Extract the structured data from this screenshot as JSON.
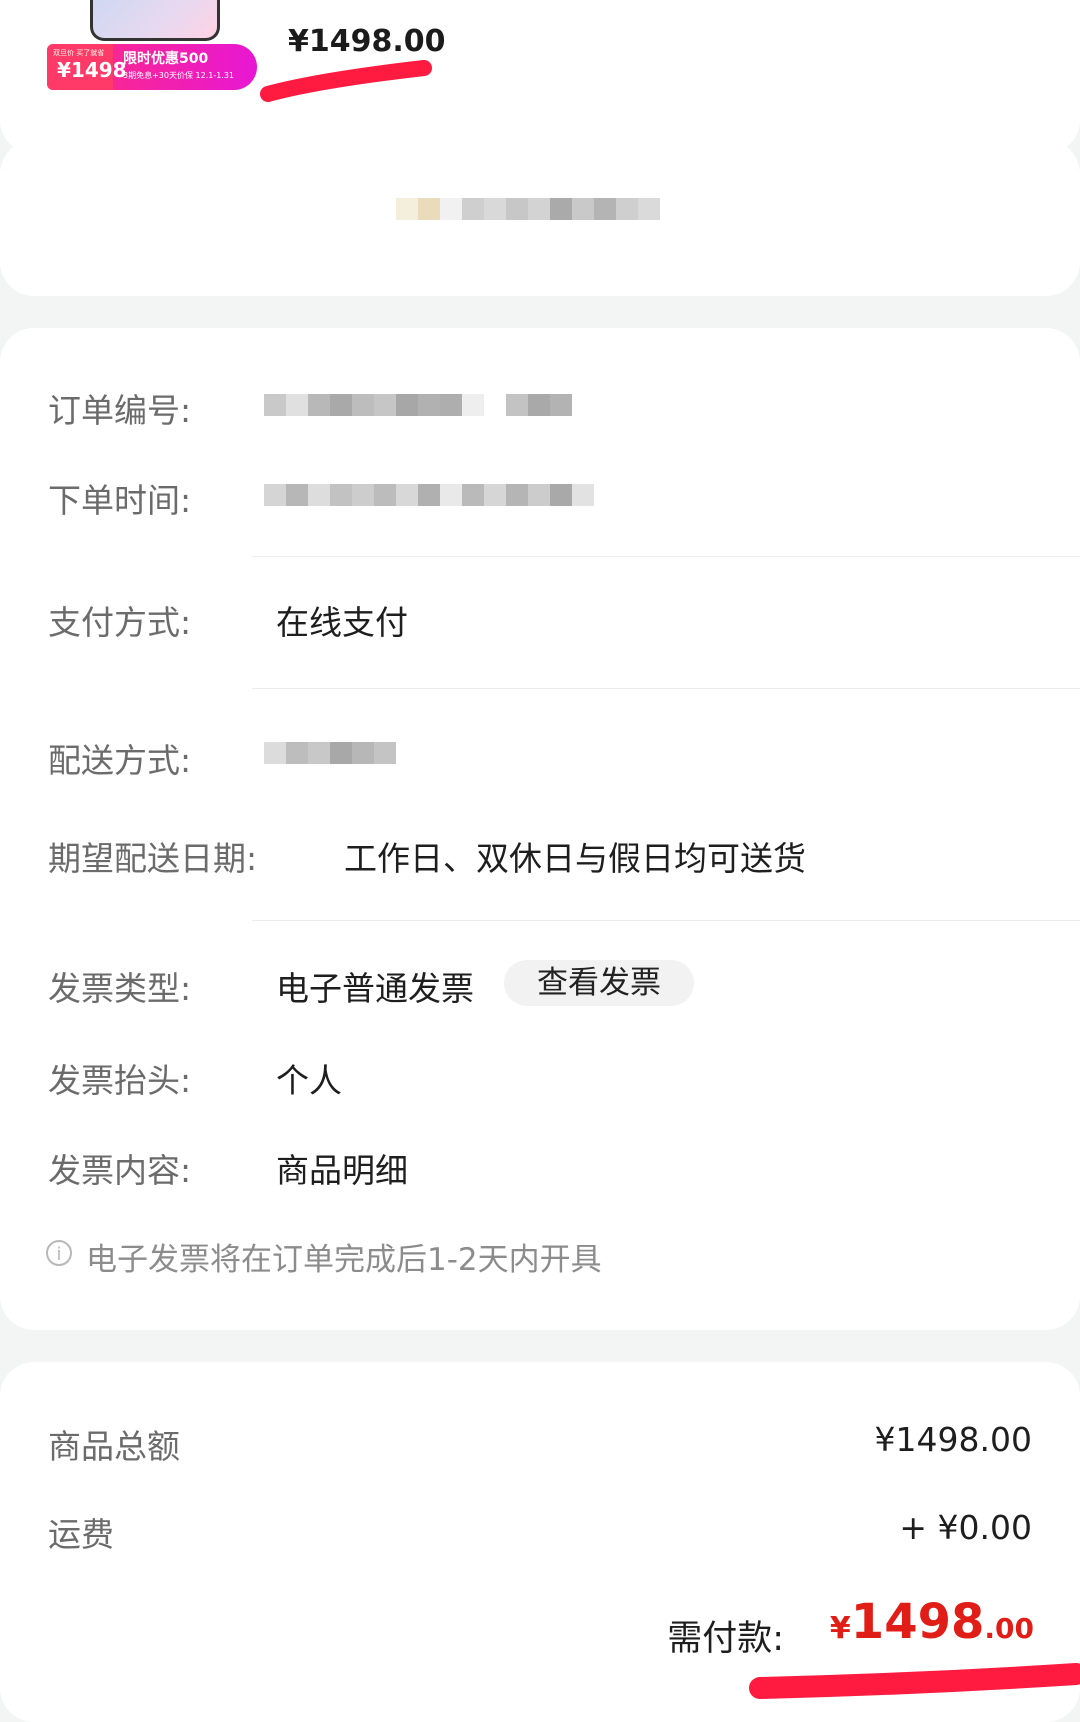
{
  "product": {
    "price": "¥1498.00",
    "promo": {
      "badge": "双旦价 买了就省",
      "price": "¥1498",
      "title": "限时优惠500",
      "subtitle": "3期免息+30天价保 12.1-1.31"
    }
  },
  "order_info": {
    "order_number_label": "订单编号:",
    "order_time_label": "下单时间:",
    "payment_label": "支付方式:",
    "payment_value": "在线支付",
    "delivery_label": "配送方式:",
    "expected_delivery_label": "期望配送日期:",
    "expected_delivery_value": "工作日、双休日与假日均可送货",
    "invoice_type_label": "发票类型:",
    "invoice_type_value": "电子普通发票",
    "view_invoice_button": "查看发票",
    "invoice_title_label": "发票抬头:",
    "invoice_title_value": "个人",
    "invoice_content_label": "发票内容:",
    "invoice_content_value": "商品明细",
    "note": "电子发票将在订单完成后1-2天内开具"
  },
  "summary": {
    "goods_total_label": "商品总额",
    "goods_total_value": "¥1498.00",
    "shipping_label": "运费",
    "shipping_value": "+ ¥0.00",
    "payable_label": "需付款:",
    "payable_currency": "¥",
    "payable_integer": "1498",
    "payable_decimal": ".00"
  },
  "colors": {
    "accent": "#e01e17",
    "annotation": "#ff1a40"
  }
}
